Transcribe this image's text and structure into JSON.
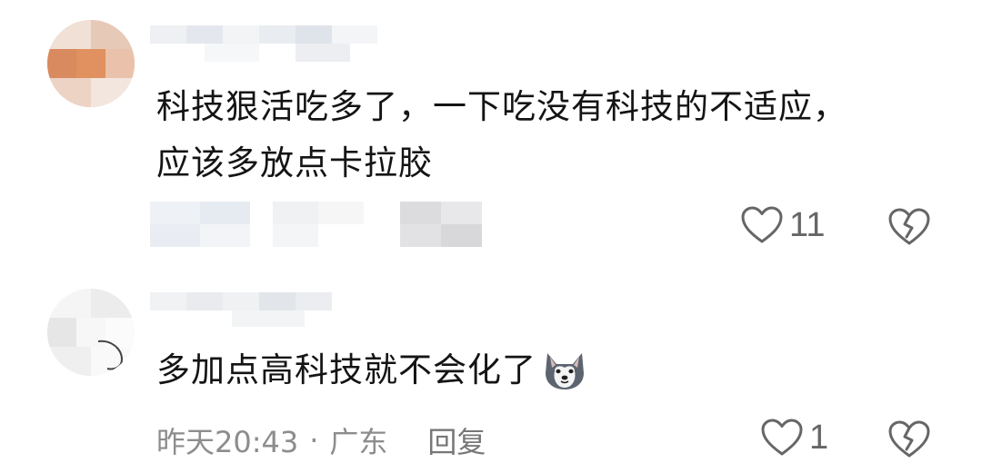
{
  "comments": [
    {
      "text_lines": [
        "科技狠活吃多了，一下吃没有科技的不适应，",
        "应该多放点卡拉胶"
      ],
      "like_count": "11",
      "icons": {
        "like": "heart-outline-icon",
        "dislike": "broken-heart-icon"
      }
    },
    {
      "text": "多加点高科技就不会化了",
      "emoji": "husky-dog-emoji",
      "timestamp": "昨天20:43",
      "separator": "·",
      "location": "广东",
      "reply_label": "回复",
      "like_count": "1",
      "icons": {
        "like": "heart-outline-icon",
        "dislike": "broken-heart-icon"
      }
    }
  ]
}
